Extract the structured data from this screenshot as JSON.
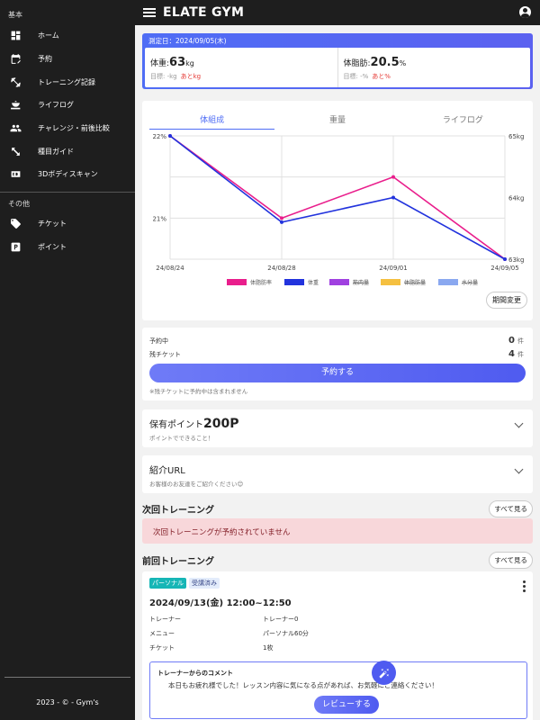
{
  "app": {
    "title": "ELATE GYM"
  },
  "sidebar": {
    "sections": [
      {
        "label": "基本",
        "items": [
          {
            "label": "ホーム",
            "icon": "dashboard-icon"
          },
          {
            "label": "予約",
            "icon": "calendar-edit-icon"
          },
          {
            "label": "トレーニング記録",
            "icon": "dumbbell-icon"
          },
          {
            "label": "ライフログ",
            "icon": "dining-icon"
          },
          {
            "label": "チャレンジ・前後比較",
            "icon": "people-icon"
          },
          {
            "label": "種目ガイド",
            "icon": "expand-arrows-icon"
          },
          {
            "label": "3Dボディスキャン",
            "icon": "3d-icon"
          }
        ]
      },
      {
        "label": "その他",
        "items": [
          {
            "label": "チケット",
            "icon": "tag-icon"
          },
          {
            "label": "ポイント",
            "icon": "parking-icon"
          }
        ]
      }
    ],
    "footer": "2023 - © - Gym's"
  },
  "measurement": {
    "date_label": "測定日：2024/09/05(木)",
    "weight": {
      "label": "体重:",
      "value": "63",
      "unit": "kg",
      "target": "目標: -kg",
      "remaining": "あとkg"
    },
    "body_fat": {
      "label": "体脂肪:",
      "value": "20.5",
      "unit": "%",
      "target": "目標: -%",
      "remaining": "あと%"
    }
  },
  "chart_tabs": [
    "体組成",
    "重量",
    "ライフログ"
  ],
  "chart_data": {
    "type": "line",
    "x": [
      "24/08/24",
      "24/08/28",
      "24/09/01",
      "24/09/05"
    ],
    "series": [
      {
        "name": "体脂肪率",
        "values": [
          22,
          21.0,
          21.5,
          20.5
        ],
        "axis": "left",
        "color": "#e91e8c"
      },
      {
        "name": "体重",
        "values": [
          65,
          63.6,
          64,
          63
        ],
        "axis": "right",
        "color": "#2233dd"
      }
    ],
    "hidden_series": [
      {
        "name": "筋肉量",
        "color": "#a040e0"
      },
      {
        "name": "体脂肪量",
        "color": "#f5c040"
      },
      {
        "name": "水分量",
        "color": "#8aa8f0"
      }
    ],
    "y_left_ticks": [
      "22%",
      "21%"
    ],
    "y_left_range": [
      20.5,
      22
    ],
    "y_right_ticks": [
      "65kg",
      "64kg",
      "63kg"
    ],
    "y_right_range": [
      63,
      65
    ],
    "grid": true,
    "legend": "bottom"
  },
  "period_button": "期間変更",
  "reservation": {
    "reserved_label": "予約中",
    "reserved_count": "0",
    "tickets_label": "残チケット",
    "tickets_count": "4",
    "unit": "件",
    "button": "予約する",
    "note": "※残チケットに予約中は含まれません"
  },
  "points": {
    "title": "保有ポイント",
    "value": "200P",
    "sub": "ポイントでできること！"
  },
  "referral": {
    "title": "紹介URL",
    "sub": "お客様のお友達をご紹介ください😊"
  },
  "next_training": {
    "title": "次回トレーニング",
    "see_all": "すべて見る",
    "empty": "次回トレーニングが予約されていません"
  },
  "last_training": {
    "title": "前回トレーニング",
    "see_all": "すべて見る",
    "badge_type": "パーソナル",
    "badge_status": "受講済み",
    "datetime": "2024/09/13(金) 12:00~12:50",
    "rows": [
      {
        "k": "トレーナー",
        "v": "トレーナー0"
      },
      {
        "k": "メニュー",
        "v": "パーソナル60分"
      },
      {
        "k": "チケット",
        "v": "1枚"
      }
    ],
    "comment_title": "トレーナーからのコメント",
    "comment": "本日もお疲れ様でした！レッスン内容に気になる点があれば、お気軽にご連絡ください！",
    "review_button": "レビューする"
  }
}
